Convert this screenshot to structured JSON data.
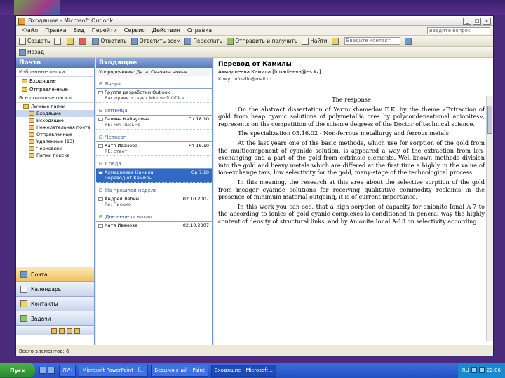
{
  "window": {
    "title": "Входящие - Microsoft Outlook"
  },
  "menu": [
    "Файл",
    "Правка",
    "Вид",
    "Перейти",
    "Сервис",
    "Действия",
    "Справка"
  ],
  "help_placeholder": "Введите вопрос",
  "toolbar": {
    "create": "Создать",
    "reply": "Ответить",
    "reply_all": "Ответить всем",
    "forward": "Переслать",
    "send_receive": "Отправить и получить",
    "find": "Найти",
    "contact_placeholder": "Введите контакт"
  },
  "toolbar2": {
    "back": "Назад"
  },
  "nav": {
    "header": "Почта",
    "favorites_label": "Избранные папки",
    "favorites": [
      "Входящие",
      "Отправленные"
    ],
    "all_folders_label": "Все почтовые папки",
    "tree": [
      {
        "label": "Личные папки",
        "level": 1
      },
      {
        "label": "Входящие",
        "level": 2,
        "selected": true
      },
      {
        "label": "Исходящие",
        "level": 2
      },
      {
        "label": "Нежелательная почта",
        "level": 2
      },
      {
        "label": "Отправленные",
        "level": 2
      },
      {
        "label": "Удаленные (13)",
        "level": 2
      },
      {
        "label": "Черновики",
        "level": 2
      },
      {
        "label": "Папки поиска",
        "level": 2
      }
    ],
    "buttons": [
      "Почта",
      "Календарь",
      "Контакты",
      "Задачи"
    ]
  },
  "list": {
    "header": "Входящие",
    "sort_label": "Упорядочение: Дата",
    "sort_order": "Сначала новые",
    "groups": [
      {
        "name": "Вчера",
        "messages": [
          {
            "from": "Группа разработки Outlook",
            "date": "",
            "subject": "Вас приветствует Microsoft Office",
            "selected": false
          }
        ]
      },
      {
        "name": "Пятница",
        "messages": [
          {
            "from": "Галина Кайнулина",
            "date": "Пт 18.10",
            "subject": "RE: Fw: Письмо",
            "selected": false
          }
        ]
      },
      {
        "name": "Четверг",
        "messages": [
          {
            "from": "Катя Иванова",
            "date": "Чт 16.10",
            "subject": "RE: ответ",
            "selected": false
          }
        ]
      },
      {
        "name": "Среда",
        "messages": [
          {
            "from": "Ахмадиеева Камила",
            "date": "Ср 7.10",
            "subject": "Перевод от Камилы",
            "selected": true
          }
        ]
      },
      {
        "name": "На прошлой неделе",
        "messages": [
          {
            "from": "Андрей Лебин",
            "date": "02.10.2007",
            "subject": "Re: Письмо",
            "selected": false
          }
        ]
      },
      {
        "name": "Две недели назад",
        "messages": [
          {
            "from": "Катя Иванова",
            "date": "02.10.2007",
            "subject": "",
            "selected": false
          }
        ]
      }
    ]
  },
  "reading": {
    "subject": "Перевод от Камилы",
    "from": "Ахмадиеева Камила [hmadieeva@es.kz]",
    "to_label": "Кому:",
    "to": "info-dfo@mail.ru"
  },
  "document": {
    "title": "The response",
    "paragraphs": [
      "On the abstract dissertation of Yarmukhamedov E.K. by the theme «Extraction of gold from heap cyanic solutions of polymetallic ores by polycondensational anionites», represents on the competition of the science degrees of the Doctor of technical science.",
      "The specialization 05.16.02 - Non-ferrous metallurgy and ferrous metals",
      "At the last years one of the basic methods, which use for sorption of the gold from the multicomponent of cyanide solution, is appeared a way of the extraction from ion-exchanging and a part of the gold from extrinsic elements. Well-known methods division into the gold and heavy metals which are differed at the first time a highly in the value of ion-exchange tars, low selectivity for the gold, many-stage of the technological process.",
      "In this meaning, the research at this area about the selective sorption of the gold from meager cyanide solutions for receiving qualitative commodity reclaims in the presence of minimum material outgoing, it is of current importance.",
      "In this work you can see, that a high sorption of capacity for anionite Ional A-7 to the according to ionics of gold cyanic complexes is conditioned in general way the highly content of density of structural links, and by Anionite Ional A-13 on selectivity according"
    ]
  },
  "status": "Всего элементов: 6",
  "taskbar": {
    "start": "Пуск",
    "tasks": [
      {
        "label": "ЛУЧ",
        "active": false
      },
      {
        "label": "Microsoft PowerPoint - [...",
        "active": false
      },
      {
        "label": "Безымянный - Paint",
        "active": false
      },
      {
        "label": "Входящие - Microsoft...",
        "active": true
      }
    ],
    "lang": "RU",
    "clock": "22:06"
  }
}
